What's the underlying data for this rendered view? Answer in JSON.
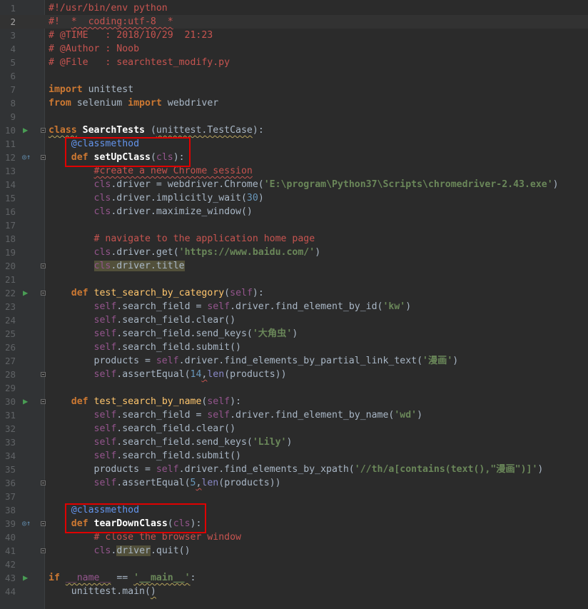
{
  "editor": {
    "current_line": 2,
    "run_markers": [
      10,
      22,
      30,
      43
    ],
    "override_markers": [
      12,
      39
    ],
    "highlight_boxes": [
      "setUpClass",
      "tearDownClass"
    ],
    "lines": [
      {
        "n": "1",
        "tokens": [
          {
            "t": "#!/usr/bin/env python",
            "c": "red"
          }
        ]
      },
      {
        "n": "2",
        "tokens": [
          {
            "t": "#!  ",
            "c": "red"
          },
          {
            "t": "*  coding:utf-8  *",
            "c": "red wavyr"
          }
        ]
      },
      {
        "n": "3",
        "tokens": [
          {
            "t": "# @TIME   : 2018/10/29  21:23",
            "c": "red"
          }
        ]
      },
      {
        "n": "4",
        "tokens": [
          {
            "t": "# @Author : Noob",
            "c": "red"
          }
        ]
      },
      {
        "n": "5",
        "tokens": [
          {
            "t": "# @File   : searchtest_modify.py",
            "c": "red"
          }
        ]
      },
      {
        "n": "6",
        "tokens": []
      },
      {
        "n": "7",
        "tokens": [
          {
            "t": "import",
            "c": "kw"
          },
          {
            "t": " unittest",
            "c": ""
          }
        ]
      },
      {
        "n": "8",
        "tokens": [
          {
            "t": "from",
            "c": "kw"
          },
          {
            "t": " selenium ",
            "c": ""
          },
          {
            "t": "import",
            "c": "kw"
          },
          {
            "t": " webdriver",
            "c": ""
          }
        ]
      },
      {
        "n": "9",
        "tokens": []
      },
      {
        "n": "10",
        "tokens": [
          {
            "t": "class",
            "c": "kw wavy"
          },
          {
            "t": " ",
            "c": ""
          },
          {
            "t": "SearchTests",
            "c": "fnb"
          },
          {
            "t": " (",
            "c": ""
          },
          {
            "t": "unittest.TestCase",
            "c": "wavy"
          },
          {
            "t": "):",
            "c": ""
          }
        ]
      },
      {
        "n": "11",
        "tokens": [
          {
            "t": "    @classmethod",
            "c": "dec"
          }
        ]
      },
      {
        "n": "12",
        "tokens": [
          {
            "t": "    ",
            "c": ""
          },
          {
            "t": "def",
            "c": "kw"
          },
          {
            "t": " ",
            "c": ""
          },
          {
            "t": "setUpClass",
            "c": "fnb"
          },
          {
            "t": "(",
            "c": ""
          },
          {
            "t": "cls",
            "c": "self"
          },
          {
            "t": "):",
            "c": ""
          }
        ]
      },
      {
        "n": "13",
        "tokens": [
          {
            "t": "        ",
            "c": ""
          },
          {
            "t": "#create a new Chrome session",
            "c": "red wavyr"
          }
        ]
      },
      {
        "n": "14",
        "tokens": [
          {
            "t": "        ",
            "c": ""
          },
          {
            "t": "cls",
            "c": "self"
          },
          {
            "t": ".driver = webdriver.Chrome(",
            "c": ""
          },
          {
            "t": "'E:\\program\\Python37\\Scripts\\chromedriver-2.43.exe'",
            "c": "strb"
          },
          {
            "t": ")",
            "c": ""
          }
        ]
      },
      {
        "n": "15",
        "tokens": [
          {
            "t": "        ",
            "c": ""
          },
          {
            "t": "cls",
            "c": "self"
          },
          {
            "t": ".driver.implicitly_wait(",
            "c": ""
          },
          {
            "t": "30",
            "c": "num"
          },
          {
            "t": ")",
            "c": ""
          }
        ]
      },
      {
        "n": "16",
        "tokens": [
          {
            "t": "        ",
            "c": ""
          },
          {
            "t": "cls",
            "c": "self"
          },
          {
            "t": ".driver.maximize_window()",
            "c": ""
          }
        ]
      },
      {
        "n": "17",
        "tokens": []
      },
      {
        "n": "18",
        "tokens": [
          {
            "t": "        ",
            "c": ""
          },
          {
            "t": "# navigate to the application home page",
            "c": "red"
          }
        ]
      },
      {
        "n": "19",
        "tokens": [
          {
            "t": "        ",
            "c": ""
          },
          {
            "t": "cls",
            "c": "self"
          },
          {
            "t": ".driver.get(",
            "c": ""
          },
          {
            "t": "'https://www.baidu.com/'",
            "c": "strb"
          },
          {
            "t": ")",
            "c": ""
          }
        ]
      },
      {
        "n": "20",
        "tokens": [
          {
            "t": "        ",
            "c": ""
          },
          {
            "t": "cls",
            "c": "self hl"
          },
          {
            "t": ".driver.title",
            "c": "hl"
          }
        ]
      },
      {
        "n": "21",
        "tokens": []
      },
      {
        "n": "22",
        "tokens": [
          {
            "t": "    ",
            "c": ""
          },
          {
            "t": "def",
            "c": "kw"
          },
          {
            "t": " ",
            "c": ""
          },
          {
            "t": "test_search_by_category",
            "c": "fn"
          },
          {
            "t": "(",
            "c": ""
          },
          {
            "t": "self",
            "c": "self"
          },
          {
            "t": "):",
            "c": ""
          }
        ]
      },
      {
        "n": "23",
        "tokens": [
          {
            "t": "        ",
            "c": ""
          },
          {
            "t": "self",
            "c": "self"
          },
          {
            "t": ".search_field = ",
            "c": ""
          },
          {
            "t": "self",
            "c": "self"
          },
          {
            "t": ".driver.find_element_by_id(",
            "c": ""
          },
          {
            "t": "'kw'",
            "c": "strb"
          },
          {
            "t": ")",
            "c": ""
          }
        ]
      },
      {
        "n": "24",
        "tokens": [
          {
            "t": "        ",
            "c": ""
          },
          {
            "t": "self",
            "c": "self"
          },
          {
            "t": ".search_field.clear()",
            "c": ""
          }
        ]
      },
      {
        "n": "25",
        "tokens": [
          {
            "t": "        ",
            "c": ""
          },
          {
            "t": "self",
            "c": "self"
          },
          {
            "t": ".search_field.send_keys(",
            "c": ""
          },
          {
            "t": "'大角虫'",
            "c": "strb"
          },
          {
            "t": ")",
            "c": ""
          }
        ]
      },
      {
        "n": "26",
        "tokens": [
          {
            "t": "        ",
            "c": ""
          },
          {
            "t": "self",
            "c": "self"
          },
          {
            "t": ".search_field.submit()",
            "c": ""
          }
        ]
      },
      {
        "n": "27",
        "tokens": [
          {
            "t": "        products = ",
            "c": ""
          },
          {
            "t": "self",
            "c": "self"
          },
          {
            "t": ".driver.find_elements_by_partial_link_text(",
            "c": ""
          },
          {
            "t": "'漫画'",
            "c": "strb"
          },
          {
            "t": ")",
            "c": ""
          }
        ]
      },
      {
        "n": "28",
        "tokens": [
          {
            "t": "        ",
            "c": ""
          },
          {
            "t": "self",
            "c": "self"
          },
          {
            "t": ".assertEqual(",
            "c": ""
          },
          {
            "t": "14",
            "c": "num"
          },
          {
            "t": ",",
            "c": "wavyr"
          },
          {
            "t": "len",
            "c": "bi"
          },
          {
            "t": "(products))",
            "c": ""
          }
        ]
      },
      {
        "n": "29",
        "tokens": []
      },
      {
        "n": "30",
        "tokens": [
          {
            "t": "    ",
            "c": ""
          },
          {
            "t": "def",
            "c": "kw"
          },
          {
            "t": " ",
            "c": ""
          },
          {
            "t": "test_search_by_name",
            "c": "fn"
          },
          {
            "t": "(",
            "c": ""
          },
          {
            "t": "self",
            "c": "self"
          },
          {
            "t": "):",
            "c": ""
          }
        ]
      },
      {
        "n": "31",
        "tokens": [
          {
            "t": "        ",
            "c": ""
          },
          {
            "t": "self",
            "c": "self"
          },
          {
            "t": ".search_field = ",
            "c": ""
          },
          {
            "t": "self",
            "c": "self"
          },
          {
            "t": ".driver.find_element_by_name(",
            "c": ""
          },
          {
            "t": "'wd'",
            "c": "strb"
          },
          {
            "t": ")",
            "c": ""
          }
        ]
      },
      {
        "n": "32",
        "tokens": [
          {
            "t": "        ",
            "c": ""
          },
          {
            "t": "self",
            "c": "self"
          },
          {
            "t": ".search_field.clear()",
            "c": ""
          }
        ]
      },
      {
        "n": "33",
        "tokens": [
          {
            "t": "        ",
            "c": ""
          },
          {
            "t": "self",
            "c": "self"
          },
          {
            "t": ".search_field.send_keys(",
            "c": ""
          },
          {
            "t": "'Lily'",
            "c": "strb"
          },
          {
            "t": ")",
            "c": ""
          }
        ]
      },
      {
        "n": "34",
        "tokens": [
          {
            "t": "        ",
            "c": ""
          },
          {
            "t": "self",
            "c": "self"
          },
          {
            "t": ".search_field.submit()",
            "c": ""
          }
        ]
      },
      {
        "n": "35",
        "tokens": [
          {
            "t": "        products = ",
            "c": ""
          },
          {
            "t": "self",
            "c": "self"
          },
          {
            "t": ".driver.find_elements_by_xpath(",
            "c": ""
          },
          {
            "t": "'//th/a[contains(text(),\"漫画\")]'",
            "c": "strb"
          },
          {
            "t": ")",
            "c": ""
          }
        ]
      },
      {
        "n": "36",
        "tokens": [
          {
            "t": "        ",
            "c": ""
          },
          {
            "t": "self",
            "c": "self"
          },
          {
            "t": ".assertEqual(",
            "c": ""
          },
          {
            "t": "5",
            "c": "num"
          },
          {
            "t": ",",
            "c": "wavyr"
          },
          {
            "t": "len",
            "c": "bi"
          },
          {
            "t": "(products))",
            "c": ""
          }
        ]
      },
      {
        "n": "37",
        "tokens": []
      },
      {
        "n": "38",
        "tokens": [
          {
            "t": "    @classmethod",
            "c": "dec"
          }
        ]
      },
      {
        "n": "39",
        "tokens": [
          {
            "t": "    ",
            "c": ""
          },
          {
            "t": "def",
            "c": "kw"
          },
          {
            "t": " ",
            "c": ""
          },
          {
            "t": "tearDownClass",
            "c": "fnb"
          },
          {
            "t": "(",
            "c": ""
          },
          {
            "t": "cls",
            "c": "self"
          },
          {
            "t": "):",
            "c": ""
          }
        ]
      },
      {
        "n": "40",
        "tokens": [
          {
            "t": "        ",
            "c": ""
          },
          {
            "t": "# close the browser window",
            "c": "red"
          }
        ]
      },
      {
        "n": "41",
        "tokens": [
          {
            "t": "        ",
            "c": ""
          },
          {
            "t": "cls",
            "c": "self"
          },
          {
            "t": ".",
            "c": ""
          },
          {
            "t": "driver",
            "c": "hl"
          },
          {
            "t": ".quit()",
            "c": ""
          }
        ]
      },
      {
        "n": "42",
        "tokens": []
      },
      {
        "n": "43",
        "tokens": [
          {
            "t": "if",
            "c": "kw"
          },
          {
            "t": " ",
            "c": ""
          },
          {
            "t": "__name__",
            "c": "self wavy"
          },
          {
            "t": " == ",
            "c": ""
          },
          {
            "t": "'__main__'",
            "c": "strb wavy"
          },
          {
            "t": ":",
            "c": ""
          }
        ]
      },
      {
        "n": "44",
        "tokens": [
          {
            "t": "    unittest.main(",
            "c": ""
          },
          {
            "t": ")",
            "c": "wavy"
          }
        ]
      }
    ]
  }
}
